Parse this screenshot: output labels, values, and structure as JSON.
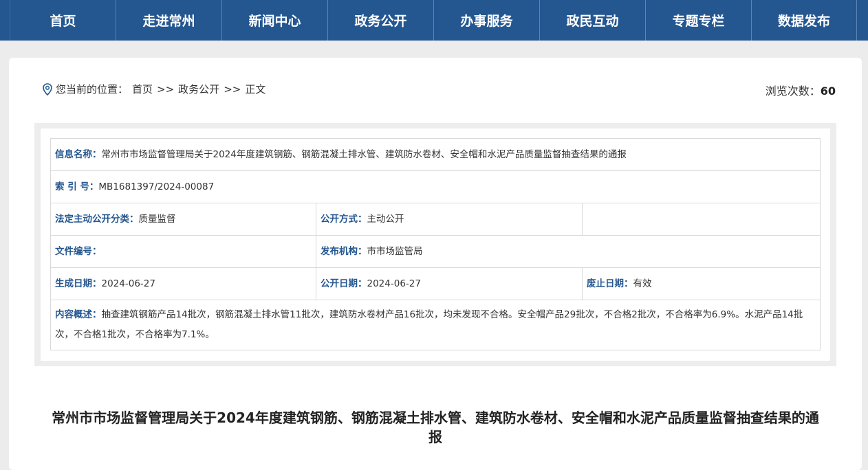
{
  "nav": [
    "首页",
    "走进常州",
    "新闻中心",
    "政务公开",
    "办事服务",
    "政民互动",
    "专题专栏",
    "数据发布"
  ],
  "location": {
    "prefix": "您当前的位置：",
    "home": "首页",
    "sep": ">>",
    "section": "政务公开",
    "current": "正文"
  },
  "views": {
    "label": "浏览次数：",
    "count": "60"
  },
  "meta": {
    "name_label": "信息名称：",
    "name": "常州市市场监督管理局关于2024年度建筑钢筋、钢筋混凝土排水管、建筑防水卷材、安全帽和水泥产品质量监督抽查结果的通报",
    "index_label": "索 引 号：",
    "index": "MB1681397/2024-00087",
    "category_label": "法定主动公开分类：",
    "category": "质量监督",
    "method_label": "公开方式：",
    "method": "主动公开",
    "docno_label": "文件编号：",
    "docno": "",
    "org_label": "发布机构：",
    "org": "市市场监管局",
    "created_label": "生成日期：",
    "created": "2024-06-27",
    "published_label": "公开日期：",
    "published": "2024-06-27",
    "expiry_label": "废止日期：",
    "expiry": "有效",
    "summary_label": "内容概述：",
    "summary": "抽查建筑钢筋产品14批次，钢筋混凝土排水管11批次，建筑防水卷材产品16批次，均未发现不合格。安全帽产品29批次，不合格2批次，不合格率为6.9%。水泥产品14批次，不合格1批次，不合格率为7.1%。"
  },
  "article": {
    "title": "常州市市场监督管理局关于2024年度建筑钢筋、钢筋混凝土排水管、建筑防水卷材、安全帽和水泥产品质量监督抽查结果的通报"
  },
  "colors": {
    "nav_bg": "#245690",
    "label_blue": "#245690",
    "page_bg": "#ececec"
  }
}
